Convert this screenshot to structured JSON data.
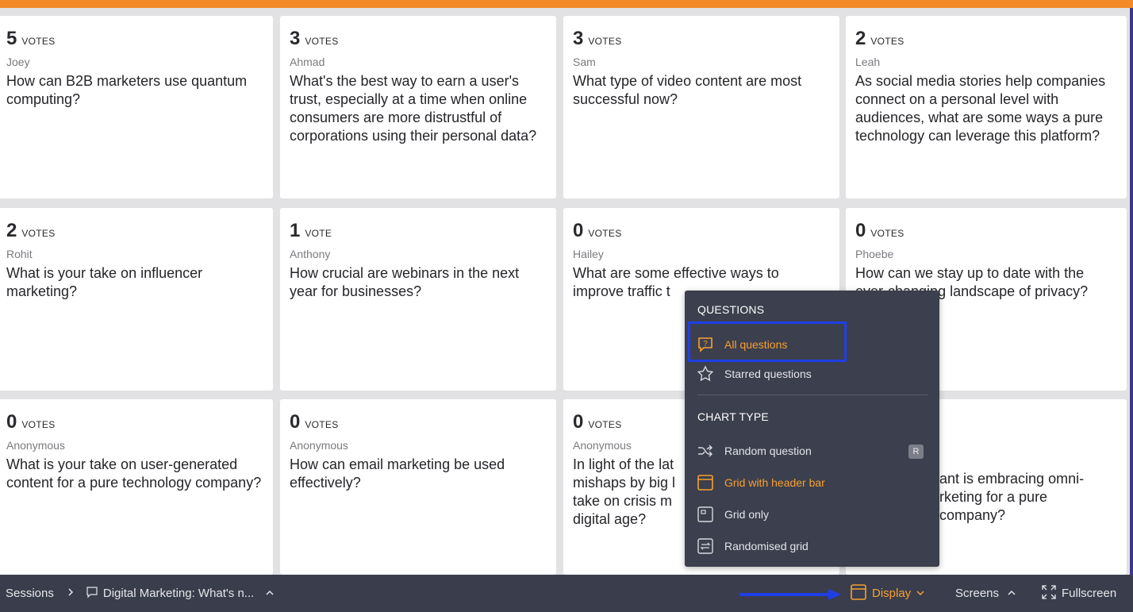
{
  "cards": [
    {
      "count": "5",
      "word": "votes",
      "author": "Joey",
      "question": "How can B2B marketers use quantum computing?"
    },
    {
      "count": "3",
      "word": "votes",
      "author": "Ahmad",
      "question": "What's the best way to earn a user's trust, especially at a time when online consumers are more distrustful of corporations using their personal data?"
    },
    {
      "count": "3",
      "word": "votes",
      "author": "Sam",
      "question": "What type of video content are most successful now?"
    },
    {
      "count": "2",
      "word": "votes",
      "author": "Leah",
      "question": "As social media stories help companies connect on a personal level with audiences, what are some ways a pure technology can leverage this platform?"
    },
    {
      "count": "2",
      "word": "votes",
      "author": "Rohit",
      "question": "What is your take on influencer marketing?"
    },
    {
      "count": "1",
      "word": "vote",
      "author": "Anthony",
      "question": "How crucial are webinars in the next year for businesses?"
    },
    {
      "count": "0",
      "word": "votes",
      "author": "Hailey",
      "question": "What are some effective ways to improve traffic t"
    },
    {
      "count": "0",
      "word": "votes",
      "author": "Phoebe",
      "question": "How can we stay up to date with the ever-changing landscape of privacy?"
    },
    {
      "count": "0",
      "word": "votes",
      "author": "Anonymous",
      "question": "What is your take on user-generated content for a pure technology company?"
    },
    {
      "count": "0",
      "word": "votes",
      "author": "Anonymous",
      "question": "How can email marketing be used effectively?"
    },
    {
      "count": "0",
      "word": "votes",
      "author": "Anonymous",
      "question": "In light of the lat mishaps by big l take on crisis m digital age?"
    },
    {
      "count": "",
      "word": "",
      "author": "",
      "question": "ant is embracing omni- rketing for a pure company?"
    }
  ],
  "menu": {
    "questions_heading": "QUESTIONS",
    "all_questions": "All questions",
    "starred_questions": "Starred questions",
    "chart_type_heading": "CHART TYPE",
    "random_question": "Random question",
    "random_shortcut": "R",
    "grid_with_header": "Grid with header bar",
    "grid_only": "Grid only",
    "randomised_grid": "Randomised grid"
  },
  "bottombar": {
    "sessions": "Sessions",
    "session_title": "Digital Marketing: What's n...",
    "display": "Display",
    "screens": "Screens",
    "fullscreen": "Fullscreen"
  },
  "colors": {
    "accent": "#f5a033",
    "top_bar": "#f28a2a",
    "highlight": "#1f3fe6",
    "menu_bg": "#3c3f4d",
    "bottom_bar_bg": "#3a3d4b"
  }
}
